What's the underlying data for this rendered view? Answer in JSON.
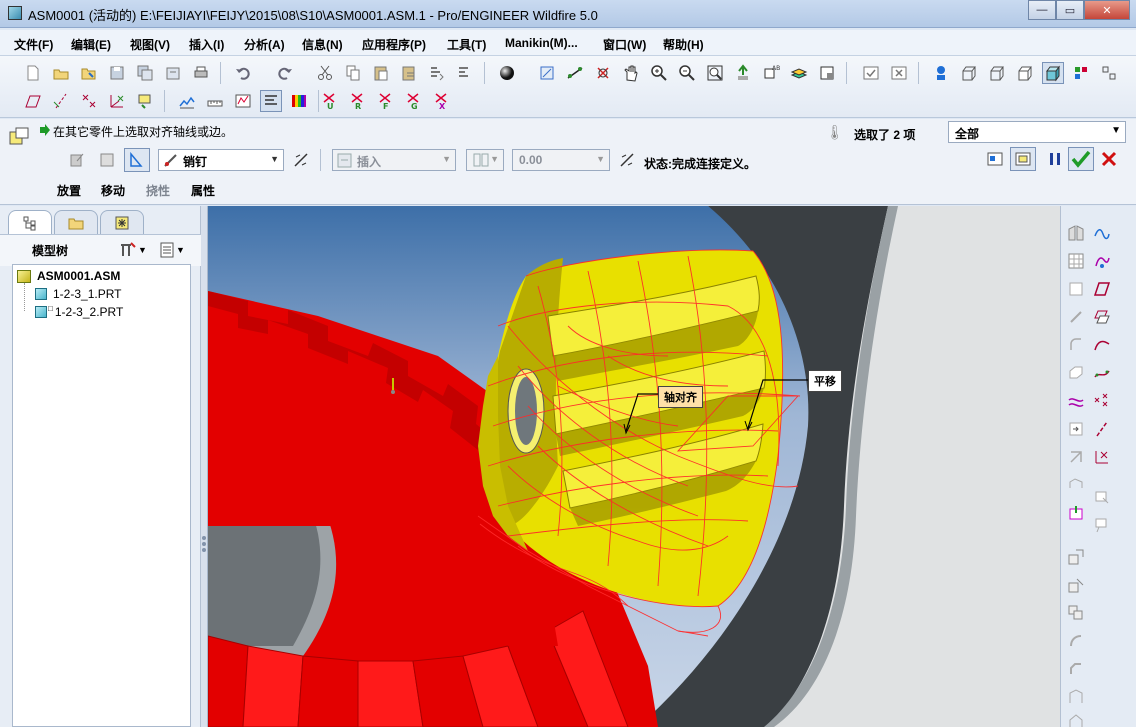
{
  "window": {
    "title": "ASM0001 (活动的) E:\\FEIJIAYI\\FEIJY\\2015\\08\\S10\\ASM0001.ASM.1 - Pro/ENGINEER Wildfire 5.0",
    "minimize": "—",
    "maximize": "▭",
    "close": "✕"
  },
  "menu": {
    "items": [
      "文件(F)",
      "编辑(E)",
      "视图(V)",
      "插入(I)",
      "分析(A)",
      "信息(N)",
      "应用程序(P)",
      "工具(T)",
      "Manikin(M)...",
      "窗口(W)",
      "帮助(H)"
    ]
  },
  "toolbar": {
    "row1_icons": [
      "new-icon",
      "open-icon",
      "open-folder-icon",
      "save-icon",
      "save-copy-icon",
      "backup-icon",
      "print-icon",
      "undo-icon",
      "redo-icon",
      "cut-icon",
      "copy-icon",
      "paste-icon",
      "paste-special-icon",
      "regenerate-icon",
      "regenerate-manager-icon",
      "shading-sphere-icon",
      "datum-plane-icon",
      "datum-axis-icon",
      "datum-point-icon",
      "pan-icon",
      "zoom-in-icon",
      "zoom-out-icon",
      "refit-icon",
      "reorient-icon",
      "saved-views-icon",
      "layers-icon",
      "view-manager-icon",
      "window-activate-icon",
      "window-close-icon",
      "model-tree-icon",
      "wireframe-icon",
      "hidden-line-icon",
      "no-hidden-icon",
      "shading-icon",
      "assembly-display-icon",
      "datum-display-icon"
    ],
    "row2_icons": [
      "plane-display-icon",
      "axis-display-icon",
      "point-display-icon",
      "csys-display-icon",
      "annotation-display-icon",
      "analysis-icon",
      "measure-icon",
      "spectrum-icon",
      "draft-check-icon",
      "color-scale-icon",
      "csys-u-icon",
      "csys-r-icon",
      "csys-f-icon",
      "csys-g-icon",
      "csys-x-icon"
    ],
    "row2_letters": [
      "U",
      "R",
      "F",
      "G",
      "X"
    ]
  },
  "dashboard": {
    "prompt": "在其它零件上选取对齐轴线或边。",
    "selection_count": "选取了 2 项",
    "filter_value": "全部",
    "connection_type": "销钉",
    "constraint_type": "插入",
    "offset_value": "0.00",
    "status": "状态:完成连接定义。",
    "tabs": [
      "放置",
      "移动",
      "挠性",
      "属性"
    ]
  },
  "model_tree": {
    "title": "模型树",
    "nodes": [
      {
        "label": "ASM0001.ASM",
        "level": 0
      },
      {
        "label": "1-2-3_1.PRT",
        "level": 1
      },
      {
        "label": "1-2-3_2.PRT",
        "level": 1
      }
    ]
  },
  "viewport": {
    "callouts": [
      "轴对齐",
      "平移"
    ]
  },
  "colors": {
    "gear_red": "#e30000",
    "gear_yellow": "#e8e000",
    "housing_grey": "#3a3f43",
    "accept_green": "#1f9b28",
    "cancel_red": "#d01010"
  }
}
